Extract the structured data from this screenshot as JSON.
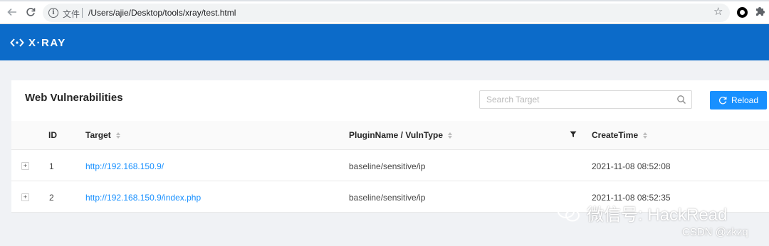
{
  "browser": {
    "file_label": "文件",
    "url": "/Users/ajie/Desktop/tools/xray/test.html"
  },
  "app": {
    "logo_text": "X·RAY",
    "brand_color": "#0c6bc9"
  },
  "card": {
    "title": "Web Vulnerabilities",
    "search_placeholder": "Search Target",
    "reload_label": "Reload"
  },
  "table": {
    "columns": {
      "id": "ID",
      "target": "Target",
      "plugin": "PluginName / VulnType",
      "create_time": "CreateTime"
    },
    "rows": [
      {
        "expand": "+",
        "id": "1",
        "target": "http://192.168.150.9/",
        "plugin": "baseline/sensitive/ip",
        "create_time": "2021-11-08 08:52:08"
      },
      {
        "expand": "+",
        "id": "2",
        "target": "http://192.168.150.9/index.php",
        "plugin": "baseline/sensitive/ip",
        "create_time": "2021-11-08 08:52:35"
      }
    ]
  },
  "watermark": {
    "brand": "微信号: HackRead",
    "csdn": "CSDN @zkzq"
  },
  "icons": [
    "back-arrow-icon",
    "refresh-icon",
    "info-icon",
    "star-icon",
    "extension-icon",
    "puzzle-icon",
    "xray-logo-icon",
    "search-icon",
    "reload-icon",
    "sort-icon",
    "filter-icon",
    "wechat-icon"
  ]
}
